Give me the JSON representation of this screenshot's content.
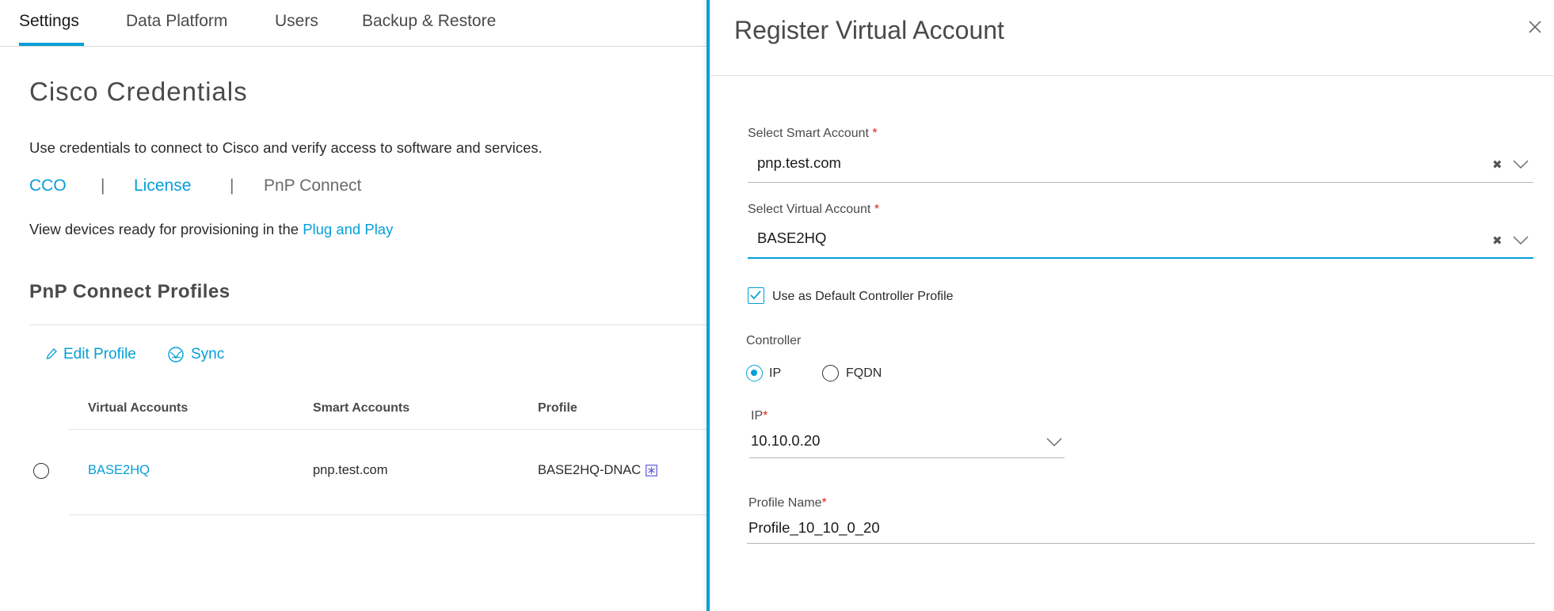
{
  "colors": {
    "accent": "#049fd9",
    "required": "#e2231a",
    "text": "#2b2b2b"
  },
  "tabs": [
    {
      "label": "Settings",
      "active": true
    },
    {
      "label": "Data Platform",
      "active": false
    },
    {
      "label": "Users",
      "active": false
    },
    {
      "label": "Backup & Restore",
      "active": false
    }
  ],
  "page": {
    "title": "Cisco Credentials",
    "description": "Use credentials to connect to Cisco and verify access to software and services.",
    "links": {
      "cco": "CCO",
      "separator": "|",
      "license": "License",
      "pnp_connect": "PnP Connect"
    },
    "view_devices_text": "View devices ready for provisioning in the ",
    "view_devices_link": "Plug and Play"
  },
  "profiles": {
    "title": "PnP Connect Profiles",
    "actions": {
      "edit_profile": "Edit Profile",
      "sync": "Sync",
      "edit_icon": "pencil-icon",
      "sync_icon": "sync-globe-icon"
    },
    "columns": [
      "Virtual Accounts",
      "Smart Accounts",
      "Profile"
    ],
    "rows": [
      {
        "virtual_account": "BASE2HQ",
        "smart_account": "pnp.test.com",
        "profile": "BASE2HQ-DNAC",
        "profile_icon": "asterisk-box-icon"
      }
    ]
  },
  "drawer": {
    "title": "Register Virtual Account",
    "smart_account": {
      "label": "Select Smart Account",
      "required_mark": "*",
      "value": "pnp.test.com"
    },
    "virtual_account": {
      "label": "Select Virtual Account",
      "required_mark": "*",
      "value": "BASE2HQ"
    },
    "default_profile": {
      "label": "Use as Default Controller Profile",
      "checked": true
    },
    "controller": {
      "label": "Controller",
      "options": [
        {
          "label": "IP",
          "selected": true
        },
        {
          "label": "FQDN",
          "selected": false
        }
      ]
    },
    "ip": {
      "label": "IP",
      "required_mark": "*",
      "value": "10.10.0.20"
    },
    "profile_name": {
      "label": "Profile Name",
      "required_mark": "*",
      "value": "Profile_10_10_0_20"
    }
  }
}
